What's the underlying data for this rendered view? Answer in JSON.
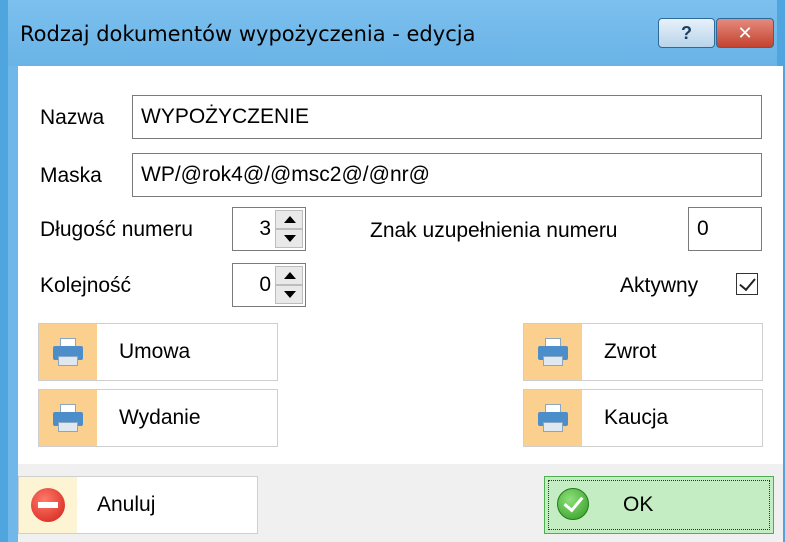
{
  "window": {
    "title": "Rodzaj dokumentów wypożyczenia - edycja",
    "help_label": "?",
    "close_label": "✕"
  },
  "form": {
    "name_label": "Nazwa",
    "name_value": "WYPOŻYCZENIE",
    "mask_label": "Maska",
    "mask_value": "WP/@rok4@/@msc2@/@nr@",
    "number_length_label": "Długość numeru",
    "number_length_value": "3",
    "fill_char_label": "Znak uzupełnienia numeru",
    "fill_char_value": "0",
    "order_label": "Kolejność",
    "order_value": "0",
    "active_label": "Aktywny",
    "active_checked": true
  },
  "print_buttons": {
    "contract": "Umowa",
    "return": "Zwrot",
    "issue": "Wydanie",
    "deposit": "Kaucja"
  },
  "footer": {
    "cancel_label": "Anuluj",
    "ok_label": "OK"
  }
}
